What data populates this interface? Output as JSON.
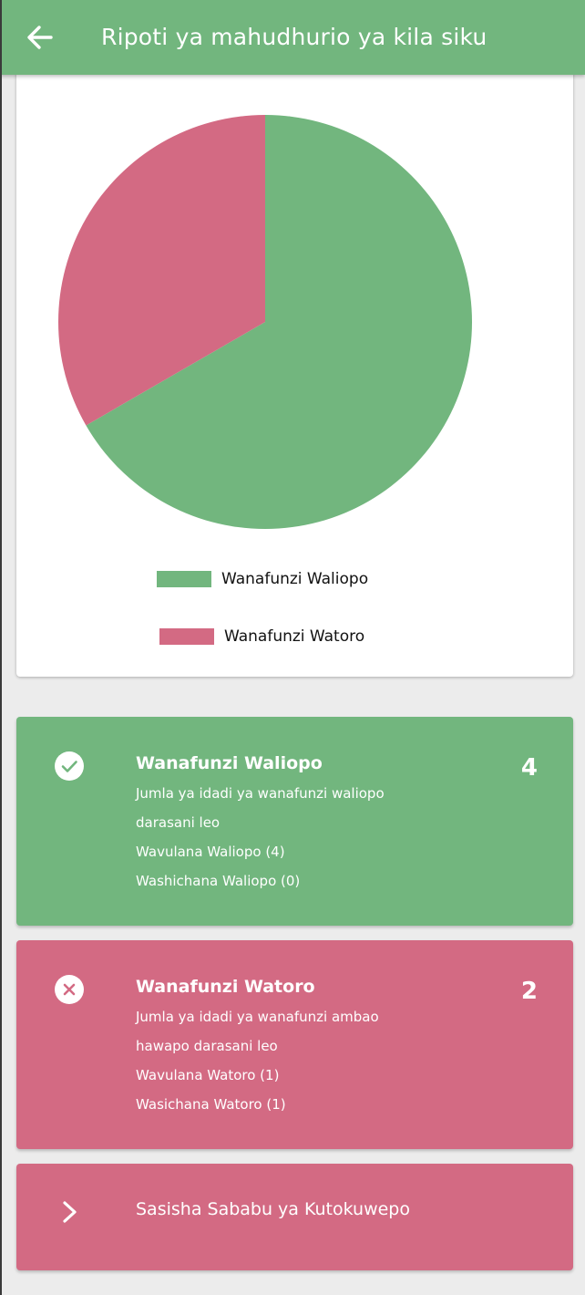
{
  "appbar": {
    "title": "Ripoti ya mahudhurio ya kila siku",
    "back_icon": "arrow-left-icon",
    "background": "#72b67e"
  },
  "chart_data": {
    "type": "pie",
    "series": [
      {
        "name": "Wanafunzi Waliopo",
        "value": 4,
        "color": "#72b67e"
      },
      {
        "name": "Wanafunzi Watoro",
        "value": 2,
        "color": "#d36a83"
      }
    ],
    "legend_position": "bottom"
  },
  "present_card": {
    "icon": "check-circle-icon",
    "title": "Wanafunzi Waliopo",
    "count": "4",
    "lines": [
      "Jumla ya idadi ya wanafunzi waliopo",
      "darasani leo",
      "Wavulana Waliopo  (4)",
      "Washichana Waliopo (0)"
    ],
    "color": "#72b67e"
  },
  "absent_card": {
    "icon": "close-circle-icon",
    "title": "Wanafunzi Watoro",
    "count": "2",
    "lines": [
      "Jumla ya idadi ya wanafunzi ambao",
      "hawapo darasani leo",
      "Wavulana Watoro  (1)",
      "Wasichana Watoro (1)"
    ],
    "color": "#d36a83"
  },
  "update_action": {
    "icon": "chevron-right-icon",
    "label": "Sasisha Sababu ya Kutokuwepo"
  }
}
